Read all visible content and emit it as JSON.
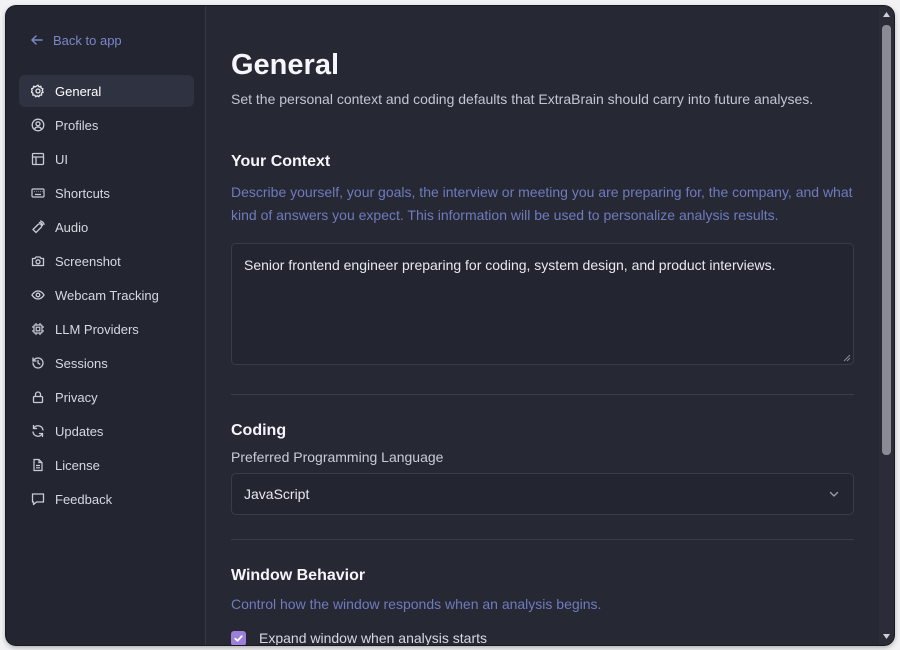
{
  "sidebar": {
    "back_label": "Back to app",
    "items": [
      {
        "label": "General",
        "icon": "gear-icon",
        "active": true
      },
      {
        "label": "Profiles",
        "icon": "user-circle-icon"
      },
      {
        "label": "UI",
        "icon": "layout-icon"
      },
      {
        "label": "Shortcuts",
        "icon": "keyboard-icon"
      },
      {
        "label": "Audio",
        "icon": "audio-icon"
      },
      {
        "label": "Screenshot",
        "icon": "camera-icon"
      },
      {
        "label": "Webcam Tracking",
        "icon": "eye-icon"
      },
      {
        "label": "LLM Providers",
        "icon": "cpu-icon"
      },
      {
        "label": "Sessions",
        "icon": "history-icon"
      },
      {
        "label": "Privacy",
        "icon": "lock-icon"
      },
      {
        "label": "Updates",
        "icon": "refresh-icon"
      },
      {
        "label": "License",
        "icon": "document-icon"
      },
      {
        "label": "Feedback",
        "icon": "message-icon"
      }
    ]
  },
  "main": {
    "title": "General",
    "subtitle": "Set the personal context and coding defaults that ExtraBrain should carry into future analyses.",
    "context": {
      "title": "Your Context",
      "description": "Describe yourself, your goals, the interview or meeting you are preparing for, the company, and what kind of answers you expect. This information will be used to personalize analysis results.",
      "value": "Senior frontend engineer preparing for coding, system design, and product interviews."
    },
    "coding": {
      "title": "Coding",
      "language_label": "Preferred Programming Language",
      "language_value": "JavaScript"
    },
    "window_behavior": {
      "title": "Window Behavior",
      "description": "Control how the window responds when an analysis begins.",
      "expand_label": "Expand window when analysis starts",
      "expand_checked": true
    }
  },
  "colors": {
    "background": "#262834",
    "sidebar": "#232530",
    "accent_text": "#6f7bbd",
    "checkbox": "#9b7fd8"
  }
}
